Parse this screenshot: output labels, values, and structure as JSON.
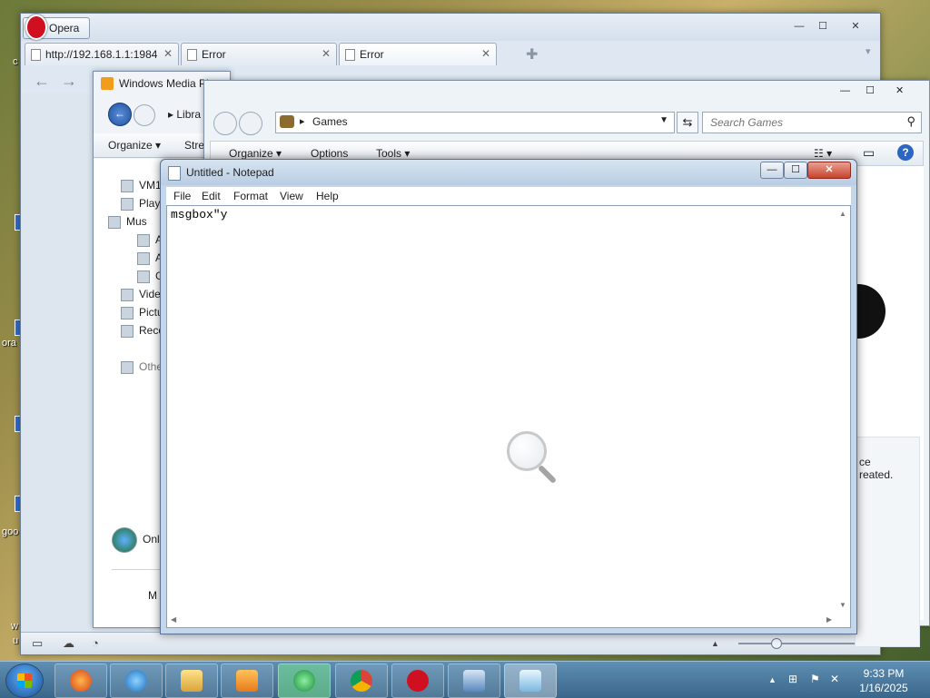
{
  "desktop": {
    "labels": [
      "c",
      "ora",
      "goo",
      "w",
      "u"
    ]
  },
  "opera": {
    "app_label": "Opera",
    "controls": [
      "—",
      "☐",
      "✕"
    ],
    "tabs": [
      {
        "label": "http://192.168.1.1:1984..."
      },
      {
        "label": "Error"
      },
      {
        "label": "Error"
      }
    ],
    "tab_close": "✕",
    "add_tab": "✚",
    "dropdown": "▾"
  },
  "wmp": {
    "title": "Windows Media Player",
    "breadcrumb": "▸ Libra",
    "organize": "Organize ▾",
    "stream": "Stre",
    "nav": [
      "VM1",
      "Play",
      "Mus",
      "A",
      "A",
      "G",
      "Vide",
      "Pictu",
      "Reco",
      "Othe",
      "Onli",
      "M"
    ]
  },
  "games": {
    "address": "Games",
    "search_placeholder": "Search Games",
    "toolbar": {
      "organize": "Organize ▾",
      "options": "Options",
      "tools": "Tools ▾"
    },
    "help": "?",
    "side_text": [
      "ce",
      "reated."
    ]
  },
  "notepad": {
    "title": "Untitled - Notepad",
    "menu": [
      "File",
      "Edit",
      "Format",
      "View",
      "Help"
    ],
    "content": "msgbox\"y"
  },
  "taskbar": {
    "apps": [
      "Firefox",
      "Internet Explorer",
      "Windows Explorer",
      "Windows Media Player",
      "Media Center",
      "Google Chrome",
      "Opera",
      "Network",
      "Notepad"
    ],
    "tray_up": "▲",
    "time": "9:33 PM",
    "date": "1/16/2025"
  },
  "colors": {
    "opera_red": "#d01020",
    "taskbar": "#3a6689",
    "accent_blue": "#2c66c2"
  }
}
